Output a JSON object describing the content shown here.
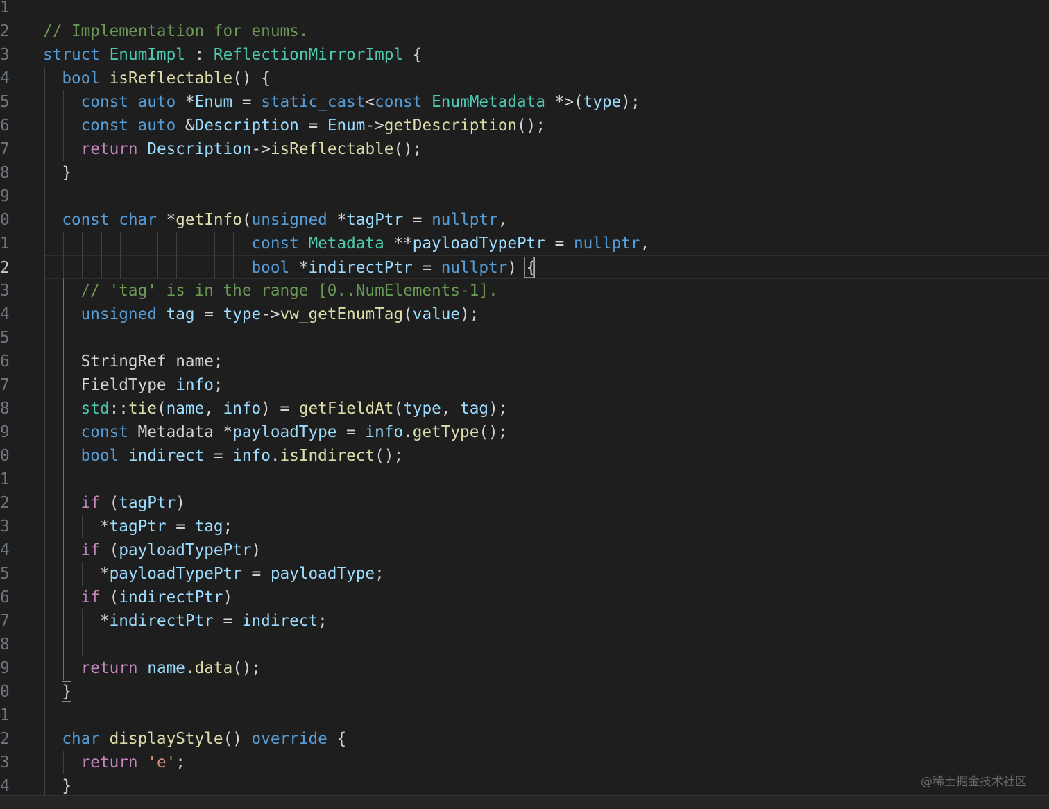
{
  "colors": {
    "background": "#1e1e1e",
    "keyword": "#569cd6",
    "control": "#c586c0",
    "type": "#4ec9b0",
    "function": "#dcdcaa",
    "variable": "#9cdcfe",
    "comment": "#6a9955",
    "string": "#ce9178",
    "plain": "#d4d4d4"
  },
  "active_line": "2",
  "watermark": "@稀土掘金技术社区",
  "lines": [
    {
      "num": "1",
      "tokens": []
    },
    {
      "num": "2",
      "tokens": [
        [
          "cm",
          "// Implementation for enums."
        ]
      ]
    },
    {
      "num": "3",
      "tokens": [
        [
          "kw",
          "struct"
        ],
        [
          "pl",
          " "
        ],
        [
          "ty",
          "EnumImpl"
        ],
        [
          "pl",
          " : "
        ],
        [
          "ty",
          "ReflectionMirrorImpl"
        ],
        [
          "pl",
          " {"
        ]
      ]
    },
    {
      "num": "4",
      "tokens": [
        [
          "pl",
          "  "
        ],
        [
          "kw",
          "bool"
        ],
        [
          "pl",
          " "
        ],
        [
          "fn",
          "isReflectable"
        ],
        [
          "pl",
          "() {"
        ]
      ]
    },
    {
      "num": "5",
      "tokens": [
        [
          "pl",
          "    "
        ],
        [
          "kw",
          "const"
        ],
        [
          "pl",
          " "
        ],
        [
          "kw",
          "auto"
        ],
        [
          "pl",
          " *"
        ],
        [
          "var",
          "Enum"
        ],
        [
          "pl",
          " = "
        ],
        [
          "kw",
          "static_cast"
        ],
        [
          "pl",
          "<"
        ],
        [
          "kw",
          "const"
        ],
        [
          "pl",
          " "
        ],
        [
          "ty",
          "EnumMetadata"
        ],
        [
          "pl",
          " *>("
        ],
        [
          "var",
          "type"
        ],
        [
          "pl",
          ");"
        ]
      ]
    },
    {
      "num": "6",
      "tokens": [
        [
          "pl",
          "    "
        ],
        [
          "kw",
          "const"
        ],
        [
          "pl",
          " "
        ],
        [
          "kw",
          "auto"
        ],
        [
          "pl",
          " &"
        ],
        [
          "var",
          "Description"
        ],
        [
          "pl",
          " = "
        ],
        [
          "var",
          "Enum"
        ],
        [
          "pl",
          "->"
        ],
        [
          "fn",
          "getDescription"
        ],
        [
          "pl",
          "();"
        ]
      ]
    },
    {
      "num": "7",
      "tokens": [
        [
          "pl",
          "    "
        ],
        [
          "ctl",
          "return"
        ],
        [
          "pl",
          " "
        ],
        [
          "var",
          "Description"
        ],
        [
          "pl",
          "->"
        ],
        [
          "fn",
          "isReflectable"
        ],
        [
          "pl",
          "();"
        ]
      ]
    },
    {
      "num": "8",
      "tokens": [
        [
          "pl",
          "  }"
        ]
      ]
    },
    {
      "num": "9",
      "tokens": []
    },
    {
      "num": "0",
      "tokens": [
        [
          "pl",
          "  "
        ],
        [
          "kw",
          "const"
        ],
        [
          "pl",
          " "
        ],
        [
          "kw",
          "char"
        ],
        [
          "pl",
          " *"
        ],
        [
          "fn",
          "getInfo"
        ],
        [
          "pl",
          "("
        ],
        [
          "kw",
          "unsigned"
        ],
        [
          "pl",
          " *"
        ],
        [
          "var",
          "tagPtr"
        ],
        [
          "pl",
          " = "
        ],
        [
          "kw",
          "nullptr"
        ],
        [
          "pl",
          ","
        ]
      ]
    },
    {
      "num": "1",
      "tokens": [
        [
          "pl",
          "                      "
        ],
        [
          "kw",
          "const"
        ],
        [
          "pl",
          " "
        ],
        [
          "ty",
          "Metadata"
        ],
        [
          "pl",
          " **"
        ],
        [
          "var",
          "payloadTypePtr"
        ],
        [
          "pl",
          " = "
        ],
        [
          "kw",
          "nullptr"
        ],
        [
          "pl",
          ","
        ]
      ]
    },
    {
      "num": "2",
      "tokens": [
        [
          "pl",
          "                      "
        ],
        [
          "kw",
          "bool"
        ],
        [
          "pl",
          " *"
        ],
        [
          "var",
          "indirectPtr"
        ],
        [
          "pl",
          " = "
        ],
        [
          "kw",
          "nullptr"
        ],
        [
          "pl",
          ") {"
        ]
      ]
    },
    {
      "num": "3",
      "tokens": [
        [
          "pl",
          "    "
        ],
        [
          "cm",
          "// 'tag' is in the range [0..NumElements-1]."
        ]
      ]
    },
    {
      "num": "4",
      "tokens": [
        [
          "pl",
          "    "
        ],
        [
          "kw",
          "unsigned"
        ],
        [
          "pl",
          " "
        ],
        [
          "var",
          "tag"
        ],
        [
          "pl",
          " = "
        ],
        [
          "var",
          "type"
        ],
        [
          "pl",
          "->"
        ],
        [
          "fn",
          "vw_getEnumTag"
        ],
        [
          "pl",
          "("
        ],
        [
          "var",
          "value"
        ],
        [
          "pl",
          ");"
        ]
      ]
    },
    {
      "num": "5",
      "tokens": []
    },
    {
      "num": "6",
      "tokens": [
        [
          "pl",
          "    StringRef name;"
        ]
      ]
    },
    {
      "num": "7",
      "tokens": [
        [
          "pl",
          "    FieldType "
        ],
        [
          "var",
          "info"
        ],
        [
          "pl",
          ";"
        ]
      ]
    },
    {
      "num": "8",
      "tokens": [
        [
          "pl",
          "    "
        ],
        [
          "ty",
          "std"
        ],
        [
          "pl",
          "::"
        ],
        [
          "fn",
          "tie"
        ],
        [
          "pl",
          "("
        ],
        [
          "var",
          "name"
        ],
        [
          "pl",
          ", "
        ],
        [
          "var",
          "info"
        ],
        [
          "pl",
          ") = "
        ],
        [
          "fn",
          "getFieldAt"
        ],
        [
          "pl",
          "("
        ],
        [
          "var",
          "type"
        ],
        [
          "pl",
          ", "
        ],
        [
          "var",
          "tag"
        ],
        [
          "pl",
          ");"
        ]
      ]
    },
    {
      "num": "9",
      "tokens": [
        [
          "pl",
          "    "
        ],
        [
          "kw",
          "const"
        ],
        [
          "pl",
          " Metadata *"
        ],
        [
          "var",
          "payloadType"
        ],
        [
          "pl",
          " = "
        ],
        [
          "var",
          "info"
        ],
        [
          "pl",
          "."
        ],
        [
          "fn",
          "getType"
        ],
        [
          "pl",
          "();"
        ]
      ]
    },
    {
      "num": "0",
      "tokens": [
        [
          "pl",
          "    "
        ],
        [
          "kw",
          "bool"
        ],
        [
          "pl",
          " "
        ],
        [
          "var",
          "indirect"
        ],
        [
          "pl",
          " = "
        ],
        [
          "var",
          "info"
        ],
        [
          "pl",
          "."
        ],
        [
          "fn",
          "isIndirect"
        ],
        [
          "pl",
          "();"
        ]
      ]
    },
    {
      "num": "1",
      "tokens": []
    },
    {
      "num": "2",
      "tokens": [
        [
          "pl",
          "    "
        ],
        [
          "ctl",
          "if"
        ],
        [
          "pl",
          " ("
        ],
        [
          "var",
          "tagPtr"
        ],
        [
          "pl",
          ")"
        ]
      ]
    },
    {
      "num": "3",
      "tokens": [
        [
          "pl",
          "      *"
        ],
        [
          "var",
          "tagPtr"
        ],
        [
          "pl",
          " = "
        ],
        [
          "var",
          "tag"
        ],
        [
          "pl",
          ";"
        ]
      ]
    },
    {
      "num": "4",
      "tokens": [
        [
          "pl",
          "    "
        ],
        [
          "ctl",
          "if"
        ],
        [
          "pl",
          " ("
        ],
        [
          "var",
          "payloadTypePtr"
        ],
        [
          "pl",
          ")"
        ]
      ]
    },
    {
      "num": "5",
      "tokens": [
        [
          "pl",
          "      *"
        ],
        [
          "var",
          "payloadTypePtr"
        ],
        [
          "pl",
          " = "
        ],
        [
          "var",
          "payloadType"
        ],
        [
          "pl",
          ";"
        ]
      ]
    },
    {
      "num": "6",
      "tokens": [
        [
          "pl",
          "    "
        ],
        [
          "ctl",
          "if"
        ],
        [
          "pl",
          " ("
        ],
        [
          "var",
          "indirectPtr"
        ],
        [
          "pl",
          ")"
        ]
      ]
    },
    {
      "num": "7",
      "tokens": [
        [
          "pl",
          "      *"
        ],
        [
          "var",
          "indirectPtr"
        ],
        [
          "pl",
          " = "
        ],
        [
          "var",
          "indirect"
        ],
        [
          "pl",
          ";"
        ]
      ]
    },
    {
      "num": "8",
      "tokens": []
    },
    {
      "num": "9",
      "tokens": [
        [
          "pl",
          "    "
        ],
        [
          "ctl",
          "return"
        ],
        [
          "pl",
          " "
        ],
        [
          "var",
          "name"
        ],
        [
          "pl",
          "."
        ],
        [
          "fn",
          "data"
        ],
        [
          "pl",
          "();"
        ]
      ]
    },
    {
      "num": "0",
      "tokens": [
        [
          "pl",
          "  }"
        ]
      ]
    },
    {
      "num": "1",
      "tokens": []
    },
    {
      "num": "2",
      "tokens": [
        [
          "pl",
          "  "
        ],
        [
          "kw",
          "char"
        ],
        [
          "pl",
          " "
        ],
        [
          "fn",
          "displayStyle"
        ],
        [
          "pl",
          "() "
        ],
        [
          "kw",
          "override"
        ],
        [
          "pl",
          " {"
        ]
      ]
    },
    {
      "num": "3",
      "tokens": [
        [
          "pl",
          "    "
        ],
        [
          "ctl",
          "return"
        ],
        [
          "pl",
          " "
        ],
        [
          "str",
          "'e'"
        ],
        [
          "pl",
          ";"
        ]
      ]
    },
    {
      "num": "4",
      "tokens": [
        [
          "pl",
          "  }"
        ]
      ]
    }
  ]
}
